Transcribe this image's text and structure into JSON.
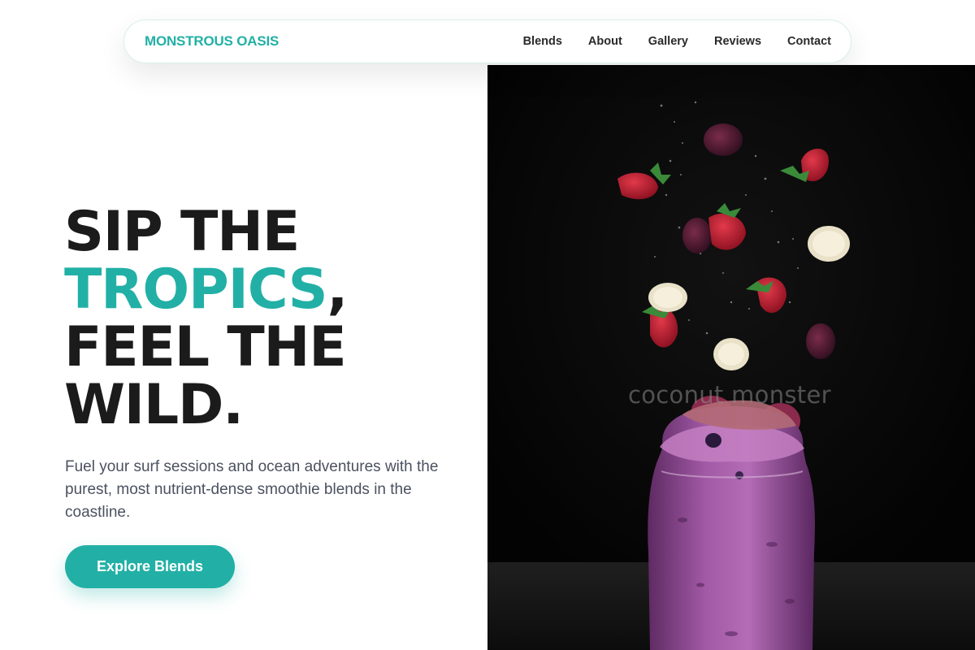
{
  "brand": {
    "name": "MONSTROUS OASIS",
    "accent_color": "#22b0a6"
  },
  "nav": {
    "links": [
      {
        "label": "Blends"
      },
      {
        "label": "About"
      },
      {
        "label": "Gallery"
      },
      {
        "label": "Reviews"
      },
      {
        "label": "Contact"
      }
    ]
  },
  "hero": {
    "headline": {
      "line1": "SIP THE",
      "line2_accent": "TROPICS",
      "line2_comma": ",",
      "line3": "FEEL THE",
      "line4": "WILD."
    },
    "subtext": "Fuel your surf sessions and ocean adventures with the purest, most nutrient-dense smoothie blends in the coastline.",
    "cta_label": "Explore Blends",
    "image": {
      "watermark_text": "coconut monster",
      "alt": "coconut monster"
    }
  }
}
